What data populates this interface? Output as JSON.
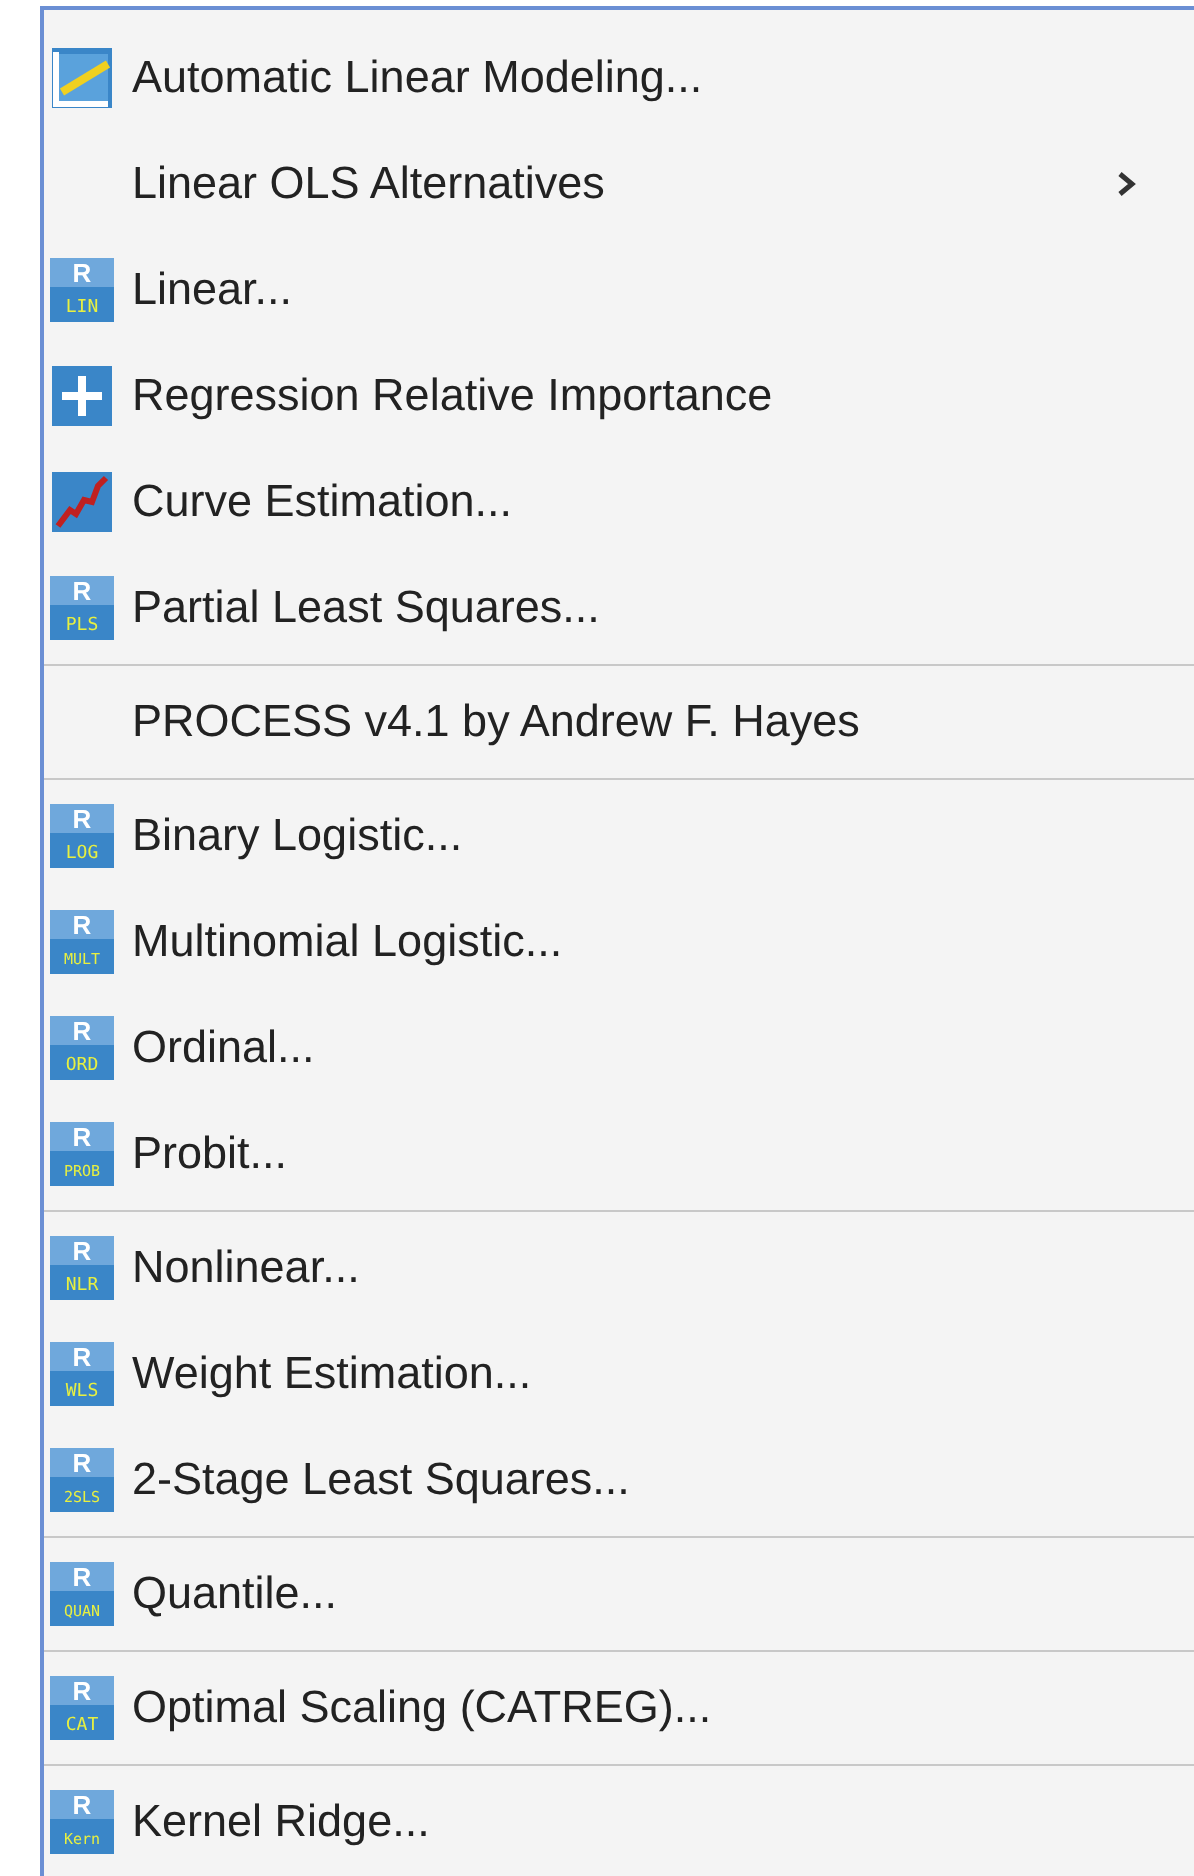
{
  "menu": {
    "groups": [
      {
        "items": [
          {
            "label": "Automatic Linear Modeling...",
            "kind": "trend",
            "has_submenu": false
          },
          {
            "label": "Linear OLS Alternatives",
            "kind": "plain",
            "has_submenu": true
          },
          {
            "label": "Linear...",
            "kind": "badge",
            "badge_letter": "R",
            "badge": "LIN",
            "has_submenu": false
          },
          {
            "label": "Regression Relative Importance",
            "kind": "plus",
            "has_submenu": false
          },
          {
            "label": "Curve Estimation...",
            "kind": "curve",
            "has_submenu": false
          },
          {
            "label": "Partial Least Squares...",
            "kind": "badge",
            "badge_letter": "R",
            "badge": "PLS",
            "has_submenu": false
          }
        ]
      },
      {
        "items": [
          {
            "label": "PROCESS v4.1 by Andrew F. Hayes",
            "kind": "plain",
            "has_submenu": false
          }
        ]
      },
      {
        "items": [
          {
            "label": "Binary Logistic...",
            "kind": "badge",
            "badge_letter": "R",
            "badge": "LOG",
            "has_submenu": false
          },
          {
            "label": "Multinomial Logistic...",
            "kind": "badge",
            "badge_letter": "R",
            "badge": "MULT",
            "has_submenu": false
          },
          {
            "label": "Ordinal...",
            "kind": "badge",
            "badge_letter": "R",
            "badge": "ORD",
            "has_submenu": false
          },
          {
            "label": "Probit...",
            "kind": "badge",
            "badge_letter": "R",
            "badge": "PROB",
            "has_submenu": false
          }
        ]
      },
      {
        "items": [
          {
            "label": "Nonlinear...",
            "kind": "badge",
            "badge_letter": "R",
            "badge": "NLR",
            "has_submenu": false
          },
          {
            "label": "Weight Estimation...",
            "kind": "badge",
            "badge_letter": "R",
            "badge": "WLS",
            "has_submenu": false
          },
          {
            "label": "2-Stage Least Squares...",
            "kind": "badge",
            "badge_letter": "R",
            "badge": "2SLS",
            "has_submenu": false
          }
        ]
      },
      {
        "items": [
          {
            "label": "Quantile...",
            "kind": "badge",
            "badge_letter": "R",
            "badge": "QUAN",
            "has_submenu": false
          }
        ]
      },
      {
        "items": [
          {
            "label": "Optimal Scaling (CATREG)...",
            "kind": "badge",
            "badge_letter": "R",
            "badge": "CAT",
            "has_submenu": false
          }
        ]
      },
      {
        "items": [
          {
            "label": "Kernel Ridge...",
            "kind": "badge",
            "badge_letter": "R",
            "badge": "Kern",
            "has_submenu": false
          }
        ]
      }
    ]
  }
}
